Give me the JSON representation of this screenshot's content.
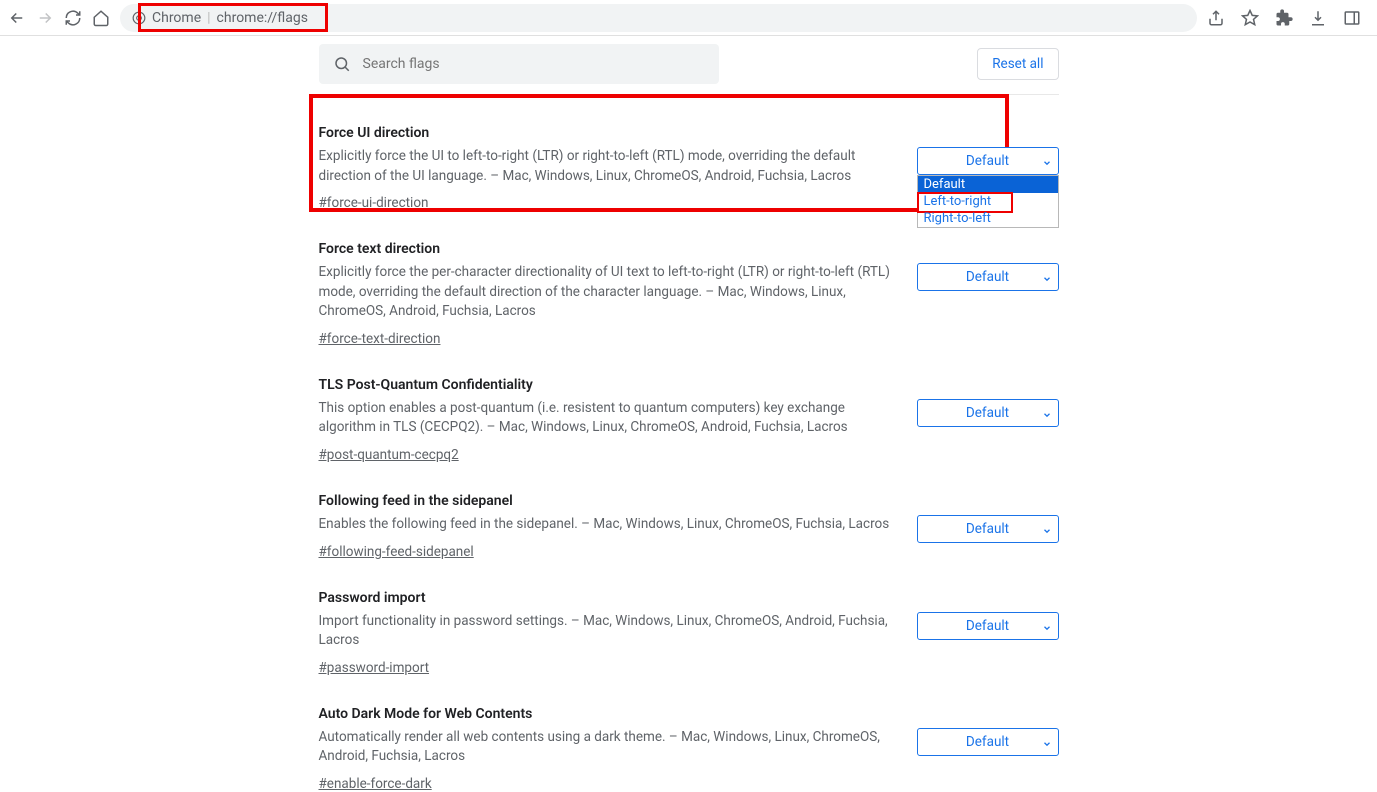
{
  "address": {
    "scheme_label": "Chrome",
    "url": "chrome://flags"
  },
  "search": {
    "placeholder": "Search flags"
  },
  "reset_label": "Reset all",
  "dropdown": {
    "options": [
      "Default",
      "Left-to-right",
      "Right-to-left"
    ],
    "selected": "Default"
  },
  "flags": [
    {
      "title": "Force UI direction",
      "desc": "Explicitly force the UI to left-to-right (LTR) or right-to-left (RTL) mode, overriding the default direction of the UI language. – Mac, Windows, Linux, ChromeOS, Android, Fuchsia, Lacros",
      "hash": "#force-ui-direction",
      "value": "Default",
      "open": true
    },
    {
      "title": "Force text direction",
      "desc": "Explicitly force the per-character directionality of UI text to left-to-right (LTR) or right-to-left (RTL) mode, overriding the default direction of the character language. – Mac, Windows, Linux, ChromeOS, Android, Fuchsia, Lacros",
      "hash": "#force-text-direction",
      "value": "Default"
    },
    {
      "title": "TLS Post-Quantum Confidentiality",
      "desc": "This option enables a post-quantum (i.e. resistent to quantum computers) key exchange algorithm in TLS (CECPQ2). – Mac, Windows, Linux, ChromeOS, Android, Fuchsia, Lacros",
      "hash": "#post-quantum-cecpq2",
      "value": "Default"
    },
    {
      "title": "Following feed in the sidepanel",
      "desc": "Enables the following feed in the sidepanel. – Mac, Windows, Linux, ChromeOS, Fuchsia, Lacros",
      "hash": "#following-feed-sidepanel",
      "value": "Default"
    },
    {
      "title": "Password import",
      "desc": "Import functionality in password settings. – Mac, Windows, Linux, ChromeOS, Android, Fuchsia, Lacros",
      "hash": "#password-import",
      "value": "Default"
    },
    {
      "title": "Auto Dark Mode for Web Contents",
      "desc": "Automatically render all web contents using a dark theme. – Mac, Windows, Linux, ChromeOS, Android, Fuchsia, Lacros",
      "hash": "#enable-force-dark",
      "value": "Default"
    }
  ]
}
